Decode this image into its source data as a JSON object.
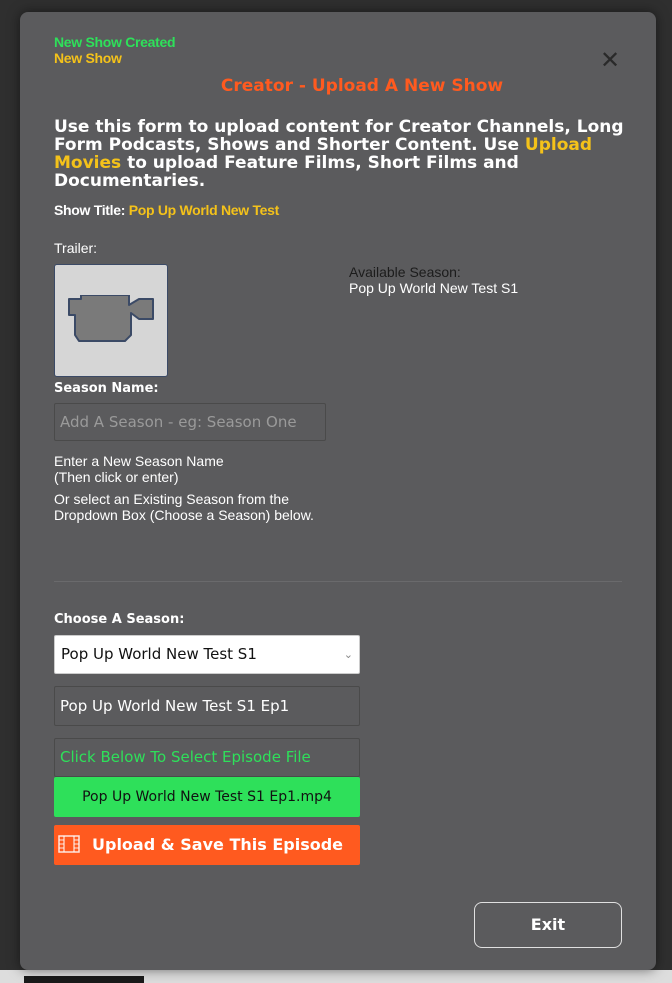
{
  "status": {
    "created": "New Show Created",
    "show": "New Show"
  },
  "modal": {
    "title": "Creator - Upload A New Show",
    "close_icon": "close-icon",
    "intro_before": "Use this form to upload content for Creator Channels, Long Form Podcasts, Shows and Shorter Content. Use ",
    "intro_link": "Upload Movies",
    "intro_after": " to upload Feature Films, Short Films and Documentaries.",
    "show_title_label": "Show Title:",
    "show_title_value": "Pop Up World New Test"
  },
  "trailer": {
    "label": "Trailer:",
    "icon": "video-camera-icon"
  },
  "available_season": {
    "label": "Available Season:",
    "value": "Pop Up World New Test S1"
  },
  "season_name": {
    "label": "Season Name:",
    "placeholder": "Add A Season - eg: Season One",
    "help_1a": "Enter a New Season Name",
    "help_1b": "(Then click or enter)",
    "help_2": "Or select an Existing Season from the Dropdown Box (Choose a Season) below."
  },
  "choose_season": {
    "label": "Choose A Season:",
    "selected": "Pop Up World New Test S1"
  },
  "episode": {
    "name": "Pop Up World New Test S1 Ep1",
    "select_file_prompt": "Click Below To Select Episode File",
    "file_name": "Pop Up World New Test S1 Ep1.mp4",
    "upload_label": "Upload & Save This Episode",
    "upload_icon": "film-icon"
  },
  "exit_label": "Exit",
  "colors": {
    "modal_bg": "#5b5b5d",
    "accent_orange": "#ff5a1f",
    "accent_yellow": "#f4c21a",
    "accent_green": "#2ee05a"
  }
}
